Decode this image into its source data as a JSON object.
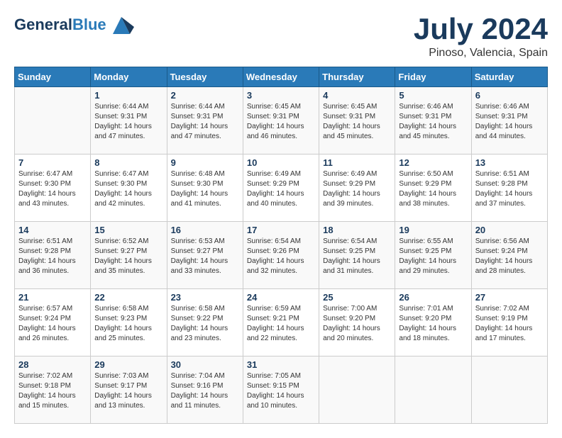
{
  "header": {
    "logo_line1": "General",
    "logo_line2": "Blue",
    "month_year": "July 2024",
    "location": "Pinoso, Valencia, Spain"
  },
  "weekdays": [
    "Sunday",
    "Monday",
    "Tuesday",
    "Wednesday",
    "Thursday",
    "Friday",
    "Saturday"
  ],
  "weeks": [
    [
      {
        "day": "",
        "sunrise": "",
        "sunset": "",
        "daylight": ""
      },
      {
        "day": "1",
        "sunrise": "Sunrise: 6:44 AM",
        "sunset": "Sunset: 9:31 PM",
        "daylight": "Daylight: 14 hours and 47 minutes."
      },
      {
        "day": "2",
        "sunrise": "Sunrise: 6:44 AM",
        "sunset": "Sunset: 9:31 PM",
        "daylight": "Daylight: 14 hours and 47 minutes."
      },
      {
        "day": "3",
        "sunrise": "Sunrise: 6:45 AM",
        "sunset": "Sunset: 9:31 PM",
        "daylight": "Daylight: 14 hours and 46 minutes."
      },
      {
        "day": "4",
        "sunrise": "Sunrise: 6:45 AM",
        "sunset": "Sunset: 9:31 PM",
        "daylight": "Daylight: 14 hours and 45 minutes."
      },
      {
        "day": "5",
        "sunrise": "Sunrise: 6:46 AM",
        "sunset": "Sunset: 9:31 PM",
        "daylight": "Daylight: 14 hours and 45 minutes."
      },
      {
        "day": "6",
        "sunrise": "Sunrise: 6:46 AM",
        "sunset": "Sunset: 9:31 PM",
        "daylight": "Daylight: 14 hours and 44 minutes."
      }
    ],
    [
      {
        "day": "7",
        "sunrise": "Sunrise: 6:47 AM",
        "sunset": "Sunset: 9:30 PM",
        "daylight": "Daylight: 14 hours and 43 minutes."
      },
      {
        "day": "8",
        "sunrise": "Sunrise: 6:47 AM",
        "sunset": "Sunset: 9:30 PM",
        "daylight": "Daylight: 14 hours and 42 minutes."
      },
      {
        "day": "9",
        "sunrise": "Sunrise: 6:48 AM",
        "sunset": "Sunset: 9:30 PM",
        "daylight": "Daylight: 14 hours and 41 minutes."
      },
      {
        "day": "10",
        "sunrise": "Sunrise: 6:49 AM",
        "sunset": "Sunset: 9:29 PM",
        "daylight": "Daylight: 14 hours and 40 minutes."
      },
      {
        "day": "11",
        "sunrise": "Sunrise: 6:49 AM",
        "sunset": "Sunset: 9:29 PM",
        "daylight": "Daylight: 14 hours and 39 minutes."
      },
      {
        "day": "12",
        "sunrise": "Sunrise: 6:50 AM",
        "sunset": "Sunset: 9:29 PM",
        "daylight": "Daylight: 14 hours and 38 minutes."
      },
      {
        "day": "13",
        "sunrise": "Sunrise: 6:51 AM",
        "sunset": "Sunset: 9:28 PM",
        "daylight": "Daylight: 14 hours and 37 minutes."
      }
    ],
    [
      {
        "day": "14",
        "sunrise": "Sunrise: 6:51 AM",
        "sunset": "Sunset: 9:28 PM",
        "daylight": "Daylight: 14 hours and 36 minutes."
      },
      {
        "day": "15",
        "sunrise": "Sunrise: 6:52 AM",
        "sunset": "Sunset: 9:27 PM",
        "daylight": "Daylight: 14 hours and 35 minutes."
      },
      {
        "day": "16",
        "sunrise": "Sunrise: 6:53 AM",
        "sunset": "Sunset: 9:27 PM",
        "daylight": "Daylight: 14 hours and 33 minutes."
      },
      {
        "day": "17",
        "sunrise": "Sunrise: 6:54 AM",
        "sunset": "Sunset: 9:26 PM",
        "daylight": "Daylight: 14 hours and 32 minutes."
      },
      {
        "day": "18",
        "sunrise": "Sunrise: 6:54 AM",
        "sunset": "Sunset: 9:25 PM",
        "daylight": "Daylight: 14 hours and 31 minutes."
      },
      {
        "day": "19",
        "sunrise": "Sunrise: 6:55 AM",
        "sunset": "Sunset: 9:25 PM",
        "daylight": "Daylight: 14 hours and 29 minutes."
      },
      {
        "day": "20",
        "sunrise": "Sunrise: 6:56 AM",
        "sunset": "Sunset: 9:24 PM",
        "daylight": "Daylight: 14 hours and 28 minutes."
      }
    ],
    [
      {
        "day": "21",
        "sunrise": "Sunrise: 6:57 AM",
        "sunset": "Sunset: 9:24 PM",
        "daylight": "Daylight: 14 hours and 26 minutes."
      },
      {
        "day": "22",
        "sunrise": "Sunrise: 6:58 AM",
        "sunset": "Sunset: 9:23 PM",
        "daylight": "Daylight: 14 hours and 25 minutes."
      },
      {
        "day": "23",
        "sunrise": "Sunrise: 6:58 AM",
        "sunset": "Sunset: 9:22 PM",
        "daylight": "Daylight: 14 hours and 23 minutes."
      },
      {
        "day": "24",
        "sunrise": "Sunrise: 6:59 AM",
        "sunset": "Sunset: 9:21 PM",
        "daylight": "Daylight: 14 hours and 22 minutes."
      },
      {
        "day": "25",
        "sunrise": "Sunrise: 7:00 AM",
        "sunset": "Sunset: 9:20 PM",
        "daylight": "Daylight: 14 hours and 20 minutes."
      },
      {
        "day": "26",
        "sunrise": "Sunrise: 7:01 AM",
        "sunset": "Sunset: 9:20 PM",
        "daylight": "Daylight: 14 hours and 18 minutes."
      },
      {
        "day": "27",
        "sunrise": "Sunrise: 7:02 AM",
        "sunset": "Sunset: 9:19 PM",
        "daylight": "Daylight: 14 hours and 17 minutes."
      }
    ],
    [
      {
        "day": "28",
        "sunrise": "Sunrise: 7:02 AM",
        "sunset": "Sunset: 9:18 PM",
        "daylight": "Daylight: 14 hours and 15 minutes."
      },
      {
        "day": "29",
        "sunrise": "Sunrise: 7:03 AM",
        "sunset": "Sunset: 9:17 PM",
        "daylight": "Daylight: 14 hours and 13 minutes."
      },
      {
        "day": "30",
        "sunrise": "Sunrise: 7:04 AM",
        "sunset": "Sunset: 9:16 PM",
        "daylight": "Daylight: 14 hours and 11 minutes."
      },
      {
        "day": "31",
        "sunrise": "Sunrise: 7:05 AM",
        "sunset": "Sunset: 9:15 PM",
        "daylight": "Daylight: 14 hours and 10 minutes."
      },
      {
        "day": "",
        "sunrise": "",
        "sunset": "",
        "daylight": ""
      },
      {
        "day": "",
        "sunrise": "",
        "sunset": "",
        "daylight": ""
      },
      {
        "day": "",
        "sunrise": "",
        "sunset": "",
        "daylight": ""
      }
    ]
  ]
}
